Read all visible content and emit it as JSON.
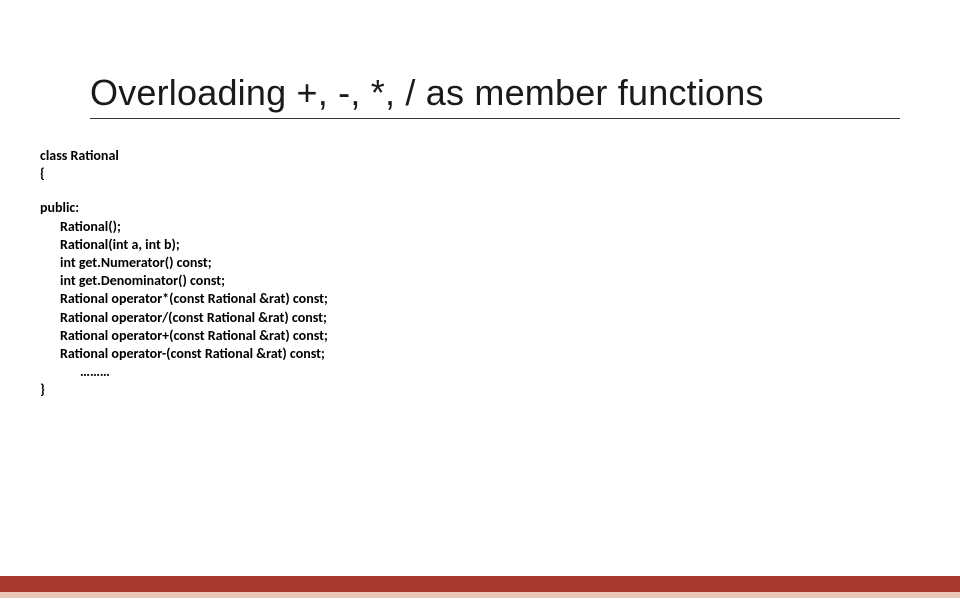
{
  "title": "Overloading +, -, *, / as member functions",
  "code": {
    "line0": "class Rational",
    "line1": "{",
    "line2": "public:",
    "line3": "Rational();",
    "line4": "Rational(int a, int b);",
    "line5": "int get.Numerator() const;",
    "line6": "int get.Denominator() const;",
    "line7": "Rational operator*(const Rational &rat) const;",
    "line8": "Rational operator/(const Rational &rat) const;",
    "line9": "Rational operator+(const Rational &rat) const;",
    "line10": "Rational operator-(const Rational &rat) const;",
    "line11": "………",
    "line12": "}"
  }
}
